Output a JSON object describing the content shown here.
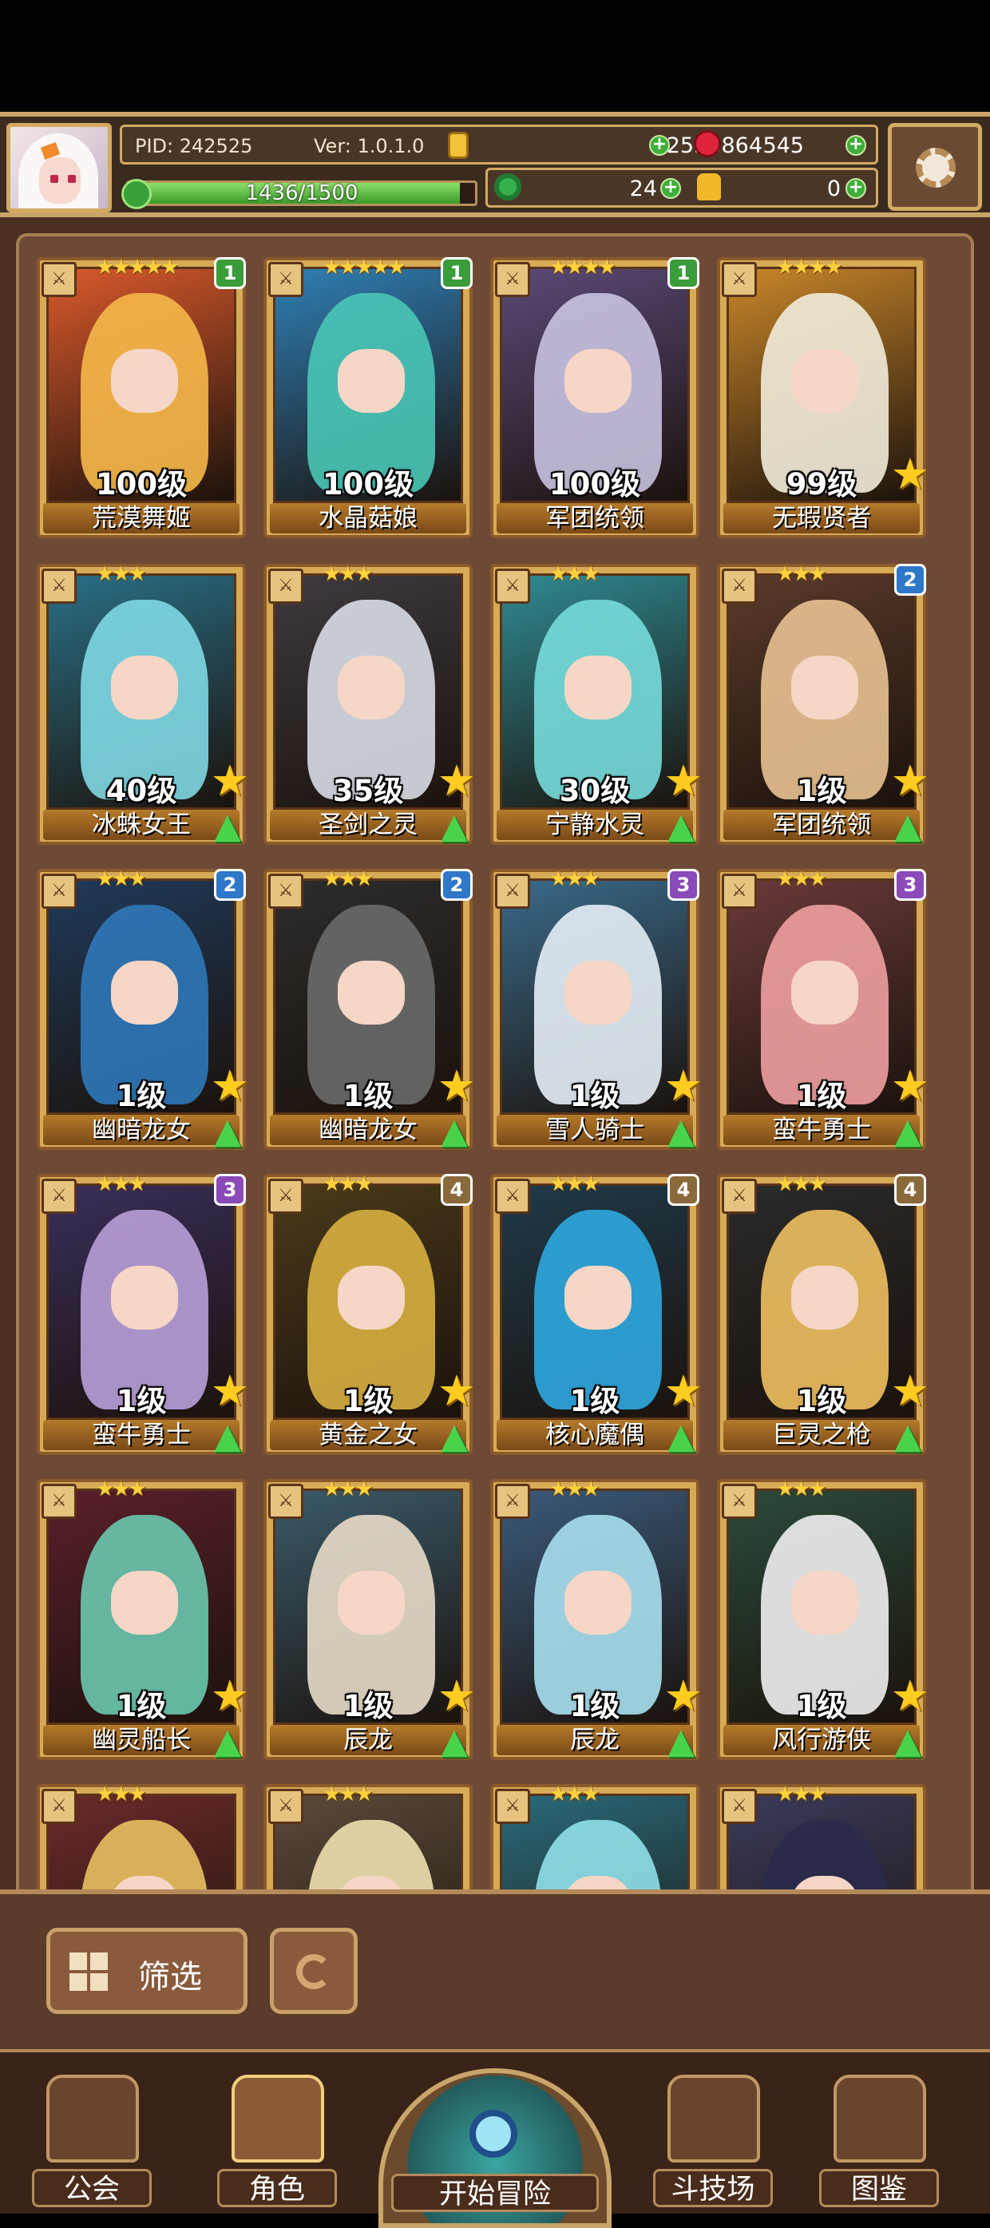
{
  "header": {
    "pid": "PID: 242525",
    "version": "Ver: 1.0.1.0",
    "gold": "2536864",
    "gems": "545",
    "exp_text": "1436/1500",
    "exp_fraction": 0.957,
    "clovers": "24",
    "tokens": "0"
  },
  "cards": [
    {
      "level": "100级",
      "name": "荒漠舞姬",
      "stars": "★★★★★",
      "rank": "1",
      "rank_color": "#3a9c3a",
      "art": "#d9592c",
      "hair": "#f6b84a"
    },
    {
      "level": "100级",
      "name": "水晶菇娘",
      "stars": "★★★★★",
      "rank": "1",
      "rank_color": "#3a9c3a",
      "art": "#2f7fb5",
      "hair": "#49c7b6"
    },
    {
      "level": "100级",
      "name": "军团统领",
      "stars": "★★★★",
      "rank": "1",
      "rank_color": "#3a9c3a",
      "art": "#5a4a78",
      "hair": "#c9c2e0"
    },
    {
      "level": "99级",
      "name": "无瑕贤者",
      "stars": "★★★★",
      "rank": "",
      "rank_color": "",
      "art": "#c9862a",
      "hair": "#f2ecda"
    },
    {
      "level": "40级",
      "name": "冰蛛女王",
      "stars": "★★★",
      "rank": "",
      "rank_color": "",
      "art": "#2a6f86",
      "hair": "#7fd8e4"
    },
    {
      "level": "35级",
      "name": "圣剑之灵",
      "stars": "★★★",
      "rank": "",
      "rank_color": "",
      "art": "#3f3a40",
      "hair": "#d8dde6"
    },
    {
      "level": "30级",
      "name": "宁静水灵",
      "stars": "★★★",
      "rank": "",
      "rank_color": "",
      "art": "#2f8a92",
      "hair": "#76dcda"
    },
    {
      "level": "1级",
      "name": "军团统领",
      "stars": "★★★",
      "rank": "2",
      "rank_color": "#2f77c8",
      "art": "#5a3a2a",
      "hair": "#e8c292"
    },
    {
      "level": "1级",
      "name": "幽暗龙女",
      "stars": "★★★",
      "rank": "2",
      "rank_color": "#2f77c8",
      "art": "#1f3a5a",
      "hair": "#2f78b8"
    },
    {
      "level": "1级",
      "name": "幽暗龙女",
      "stars": "★★★",
      "rank": "2",
      "rank_color": "#2f77c8",
      "art": "#2c2c2c",
      "hair": "#6a6a6a"
    },
    {
      "level": "1级",
      "name": "雪人骑士",
      "stars": "★★★",
      "rank": "3",
      "rank_color": "#8a4ab8",
      "art": "#3a6a8a",
      "hair": "#e6eef6"
    },
    {
      "level": "1级",
      "name": "蛮牛勇士",
      "stars": "★★★",
      "rank": "3",
      "rank_color": "#8a4ab8",
      "art": "#6a3a3a",
      "hair": "#f0a0a0"
    },
    {
      "level": "1级",
      "name": "蛮牛勇士",
      "stars": "★★★",
      "rank": "3",
      "rank_color": "#8a4ab8",
      "art": "#3a2e5a",
      "hair": "#b8a0d8"
    },
    {
      "level": "1级",
      "name": "黄金之女",
      "stars": "★★★",
      "rank": "4",
      "rank_color": "#8a6a3a",
      "art": "#4a3a1a",
      "hair": "#d8b040"
    },
    {
      "level": "1级",
      "name": "核心魔偶",
      "stars": "★★★",
      "rank": "4",
      "rank_color": "#8a6a3a",
      "art": "#1f3a4a",
      "hair": "#2fa8e0"
    },
    {
      "level": "1级",
      "name": "巨灵之枪",
      "stars": "★★★",
      "rank": "4",
      "rank_color": "#8a6a3a",
      "art": "#2a2a2a",
      "hair": "#f0c060"
    },
    {
      "level": "1级",
      "name": "幽灵船长",
      "stars": "★★★",
      "rank": "",
      "rank_color": "",
      "art": "#5a1f2a",
      "hair": "#6ac8b0"
    },
    {
      "level": "1级",
      "name": "辰龙",
      "stars": "★★★",
      "rank": "",
      "rank_color": "",
      "art": "#3a5a6a",
      "hair": "#e8dcc8"
    },
    {
      "level": "1级",
      "name": "辰龙",
      "stars": "★★★",
      "rank": "",
      "rank_color": "",
      "art": "#3a5a7a",
      "hair": "#a8e0f0"
    },
    {
      "level": "1级",
      "name": "风行游侠",
      "stars": "★★★",
      "rank": "",
      "rank_color": "",
      "art": "#2a4a3a",
      "hair": "#f0f0f0"
    },
    {
      "level": "",
      "name": "",
      "stars": "★★★",
      "rank": "",
      "rank_color": "",
      "art": "#6a2a2a",
      "hair": "#e8c060"
    },
    {
      "level": "",
      "name": "",
      "stars": "★★★",
      "rank": "",
      "rank_color": "",
      "art": "#5a4a3a",
      "hair": "#f0e0b0"
    },
    {
      "level": "",
      "name": "",
      "stars": "★★★",
      "rank": "",
      "rank_color": "",
      "art": "#2a6a7a",
      "hair": "#90e0e8"
    },
    {
      "level": "",
      "name": "",
      "stars": "★★★",
      "rank": "",
      "rank_color": "",
      "art": "#3a3a5a",
      "hair": "#2a2a4a"
    }
  ],
  "toolbar": {
    "filter_label": "筛选"
  },
  "nav": {
    "guild": "公会",
    "role": "角色",
    "adventure": "开始冒险",
    "arena": "斗技场",
    "codex": "图鉴"
  },
  "icons": {
    "settings": "gear-icon",
    "gold": "coin-icon",
    "gems": "gem-icon",
    "exp": "exp-icon",
    "clovers": "clover-icon",
    "tokens": "hand-token-icon",
    "filter": "grid-icon",
    "refresh": "refresh-icon"
  }
}
